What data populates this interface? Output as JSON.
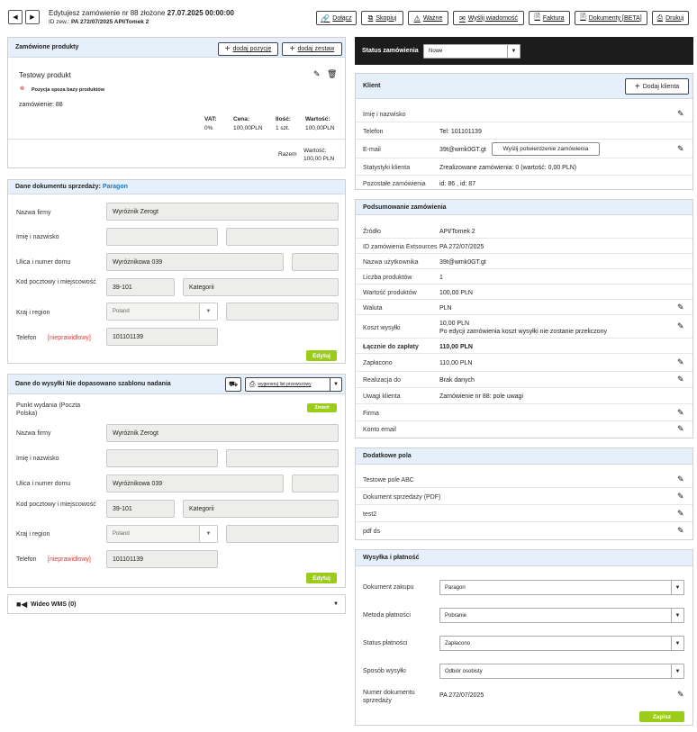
{
  "header": {
    "title_prefix": "Edytujesz zamówienie nr 88 złożone",
    "title_date": "27.07.2025 00:00:00",
    "ext_id_label": "ID zew.:",
    "ext_id_value": "PA 272/07/2025 API/Tomek 2",
    "buttons": [
      "Dołącz",
      "Skopiuj",
      "Ważne",
      "Wyślij wiadomość",
      "Faktura",
      "Dokumenty [BETA]",
      "Drukuj"
    ]
  },
  "products": {
    "title": "Zamówione produkty",
    "add_item": "dodaj pozycję",
    "add_set": "dodaj zestaw",
    "name": "Testowy produkt",
    "note": "Pozycja spoza bazy produktów",
    "order_line": "zamówienie: 88",
    "cols": {
      "vat": "VAT:",
      "price": "Cena:",
      "qty": "Ilość:",
      "value": "Wartość:"
    },
    "vals": {
      "vat": "0%",
      "price": "100,00PLN",
      "qty": "1 szt.",
      "value": "100,00PLN"
    },
    "total_label": "Razem",
    "total_value_label": "Wartość:",
    "total_value": "100,00 PLN"
  },
  "sale_doc": {
    "title": "Dane dokumentu sprzedaży:",
    "doc_type": "Paragon",
    "labels": {
      "company": "Nazwa firmy",
      "name": "Imię i nazwisko",
      "street": "Ulica i numer domu",
      "postal": "Kod pocztowy i miejscowość",
      "country": "Kraj i region",
      "phone": "Telefon"
    },
    "invalid": "[nieprawidłowy]",
    "company": "Wyróżnik Zerogt",
    "street": "Wyróżnikowa 039",
    "postal": "39-101",
    "city": "Kategorii",
    "country": "Poland",
    "phone": "101101139",
    "edit": "Edytuj"
  },
  "shipping": {
    "title": "Dane do wysyłki Nie dopasowano szablonu nadania",
    "generate": "wygeneruj list przewozowy",
    "pickup_label": "Punkt wydania (Poczta Polska)",
    "change": "Zmień",
    "labels": {
      "company": "Nazwa firmy",
      "name": "Imię i nazwisko",
      "street": "Ulica i numer domu",
      "postal": "Kod pocztowy i miejscowość",
      "country": "Kraj i region",
      "phone": "Telefon"
    },
    "invalid": "[nieprawidłowy]",
    "company": "Wyróżnik Zerogt",
    "street": "Wyróżnikowa 039",
    "postal": "39-101",
    "city": "Kategorii",
    "country": "Poland",
    "phone": "101101139",
    "edit": "Edytuj"
  },
  "video": {
    "title": "Wideo WMS (0)"
  },
  "status": {
    "label": "Status zamówienia",
    "value": "Nowe"
  },
  "client": {
    "title": "Klient",
    "add": "Dodaj klienta",
    "rows": [
      {
        "label": "Imię i nazwisko",
        "value": ""
      },
      {
        "label": "Telefon",
        "value": "Tel: 101101139"
      },
      {
        "label": "E-mail",
        "value": "39t@wmk0GT.gt"
      },
      {
        "label": "Statystyki klienta",
        "value": "Zrealizowane zamówienia: 0 (wartość: 0,00 PLN)"
      },
      {
        "label": "Pozostałe zamówienia",
        "value": "id: 86 , id: 87"
      }
    ],
    "confirm_btn": "Wyślij potwierdzenie zamówienia"
  },
  "summary": {
    "title": "Podsumowanie zamówienia",
    "rows": [
      {
        "label": "Źródło",
        "value": "API/Tomek 2"
      },
      {
        "label": "ID zamówienia Extsources",
        "value": "PA 272/07/2025"
      },
      {
        "label": "Nazwa użytkownika",
        "value": "39t@wmk0GT.gt"
      },
      {
        "label": "Liczba produktów",
        "value": "1"
      },
      {
        "label": "Wartość produktów",
        "value": "100,00 PLN"
      },
      {
        "label": "Waluta",
        "value": "PLN"
      },
      {
        "label": "Koszt wysyłki",
        "value": "10,00 PLN",
        "note": "Po edycji zamówienia koszt wysyłki nie zostanie przeliczony"
      },
      {
        "label": "Łącznie do zapłaty",
        "value": "110,00 PLN"
      },
      {
        "label": "Zapłacono",
        "value": "110,00 PLN"
      },
      {
        "label": "Realizacja do",
        "value": "Brak danych"
      },
      {
        "label": "Uwagi klienta",
        "value": "Zamówienie nr 88: pole uwagi"
      },
      {
        "label": "Firma",
        "value": ""
      },
      {
        "label": "Konto email",
        "value": ""
      }
    ]
  },
  "extra": {
    "title": "Dodatkowe pola",
    "rows": [
      "Testowe pole ABC",
      "Dokument sprzedaży (PDF)",
      "test2",
      "pdf ds"
    ]
  },
  "payment": {
    "title": "Wysyłka i płatność",
    "rows": [
      {
        "label": "Dokument zakupu",
        "value": "Paragon"
      },
      {
        "label": "Metoda płatności",
        "value": "Pobranie"
      },
      {
        "label": "Status płatności",
        "value": "Zapłacono"
      },
      {
        "label": "Sposób wysyłki",
        "value": "Odbiór osobisty"
      }
    ],
    "doc_number_label": "Numer dokumentu sprzedaży",
    "doc_number": "PA 272/07/2025",
    "save": "Zapisz"
  }
}
